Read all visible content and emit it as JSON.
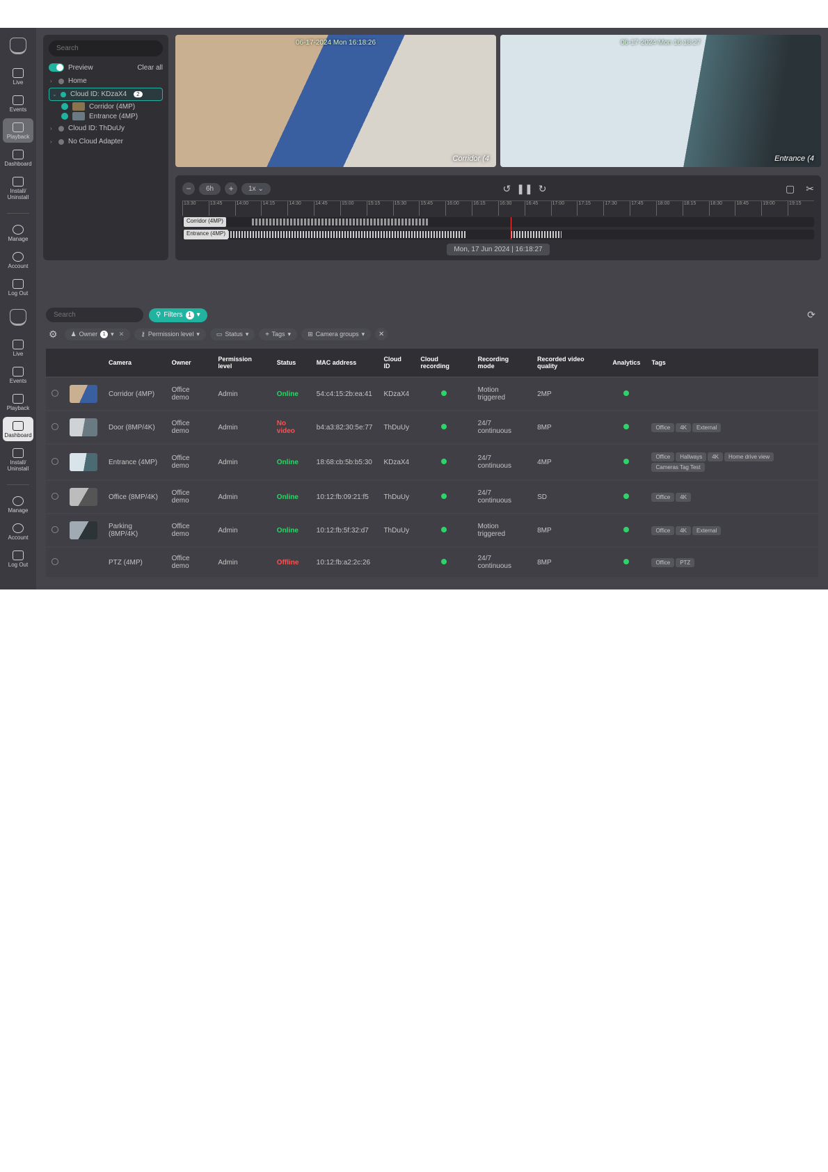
{
  "nav": {
    "items": [
      {
        "label": "Live"
      },
      {
        "label": "Events"
      },
      {
        "label": "Playback"
      },
      {
        "label": "Dashboard"
      },
      {
        "label": "Install/\nUninstall"
      }
    ],
    "lower": [
      {
        "label": "Manage"
      },
      {
        "label": "Account"
      },
      {
        "label": "Log Out"
      }
    ]
  },
  "search": {
    "placeholder": "Search"
  },
  "tree": {
    "preview": "Preview",
    "clear": "Clear all",
    "home": "Home",
    "cloud1": "Cloud ID: KDzaX4",
    "cloud1_count": "2",
    "cam1": "Corridor (4MP)",
    "cam2": "Entrance (4MP)",
    "cloud2": "Cloud ID: ThDuUy",
    "noadapter": "No Cloud Adapter"
  },
  "feeds": {
    "corr_stamp": "06-17-2024 Mon 16:18:26",
    "corr_cap": "Corridor (4",
    "entr_stamp": "06-17-2024 Mon 16:18:27",
    "entr_cap": "Entrance (4"
  },
  "timeline": {
    "range": "6h",
    "speed": "1x",
    "ticks": [
      "13:30",
      "13:45",
      "14:00",
      "14:15",
      "14:30",
      "14:45",
      "15:00",
      "15:15",
      "15:30",
      "15:45",
      "16:00",
      "16:15",
      "16:30",
      "16:45",
      "17:00",
      "17:15",
      "17:30",
      "17:45",
      "18:00",
      "18:15",
      "18:30",
      "18:45",
      "19:00",
      "19:15"
    ],
    "track1": "Corridor (4MP)",
    "track2": "Entrance (4MP)",
    "date": "Mon, 17 Jun 2024 | 16:18:27"
  },
  "dash": {
    "search_ph": "Search",
    "filters_label": "Filters",
    "filters_count": "1",
    "chips": {
      "owner": "Owner",
      "owner_count": "1",
      "perm": "Permission level",
      "status": "Status",
      "tags": "Tags",
      "groups": "Camera groups"
    },
    "headers": [
      "",
      "",
      "Camera",
      "Owner",
      "Permission level",
      "Status",
      "MAC address",
      "Cloud ID",
      "Cloud recording",
      "Recording mode",
      "Recorded video quality",
      "Analytics",
      "Tags"
    ],
    "rows": [
      {
        "camera": "Corridor (4MP)",
        "owner": "Office demo",
        "perm": "Admin",
        "status": "Online",
        "mac": "54:c4:15:2b:ea:41",
        "cloud": "KDzaX4",
        "mode": "Motion triggered",
        "quality": "2MP",
        "tags": []
      },
      {
        "camera": "Door (8MP/4K)",
        "owner": "Office demo",
        "perm": "Admin",
        "status": "No video",
        "mac": "b4:a3:82:30:5e:77",
        "cloud": "ThDuUy",
        "mode": "24/7 continuous",
        "quality": "8MP",
        "tags": [
          "Office",
          "4K",
          "External"
        ]
      },
      {
        "camera": "Entrance (4MP)",
        "owner": "Office demo",
        "perm": "Admin",
        "status": "Online",
        "mac": "18:68:cb:5b:b5:30",
        "cloud": "KDzaX4",
        "mode": "24/7 continuous",
        "quality": "4MP",
        "tags": [
          "Office",
          "Hallways",
          "4K",
          "Home drive view",
          "Cameras Tag Test"
        ]
      },
      {
        "camera": "Office (8MP/4K)",
        "owner": "Office demo",
        "perm": "Admin",
        "status": "Online",
        "mac": "10:12:fb:09:21:f5",
        "cloud": "ThDuUy",
        "mode": "24/7 continuous",
        "quality": "SD",
        "tags": [
          "Office",
          "4K"
        ]
      },
      {
        "camera": "Parking (8MP/4K)",
        "owner": "Office demo",
        "perm": "Admin",
        "status": "Online",
        "mac": "10:12:fb:5f:32:d7",
        "cloud": "ThDuUy",
        "mode": "Motion triggered",
        "quality": "8MP",
        "tags": [
          "Office",
          "4K",
          "External"
        ]
      },
      {
        "camera": "PTZ (4MP)",
        "owner": "Office demo",
        "perm": "Admin",
        "status": "Offline",
        "mac": "10:12:fb:a2:2c:26",
        "cloud": "",
        "mode": "24/7 continuous",
        "quality": "8MP",
        "tags": [
          "Office",
          "PTZ"
        ]
      }
    ]
  }
}
